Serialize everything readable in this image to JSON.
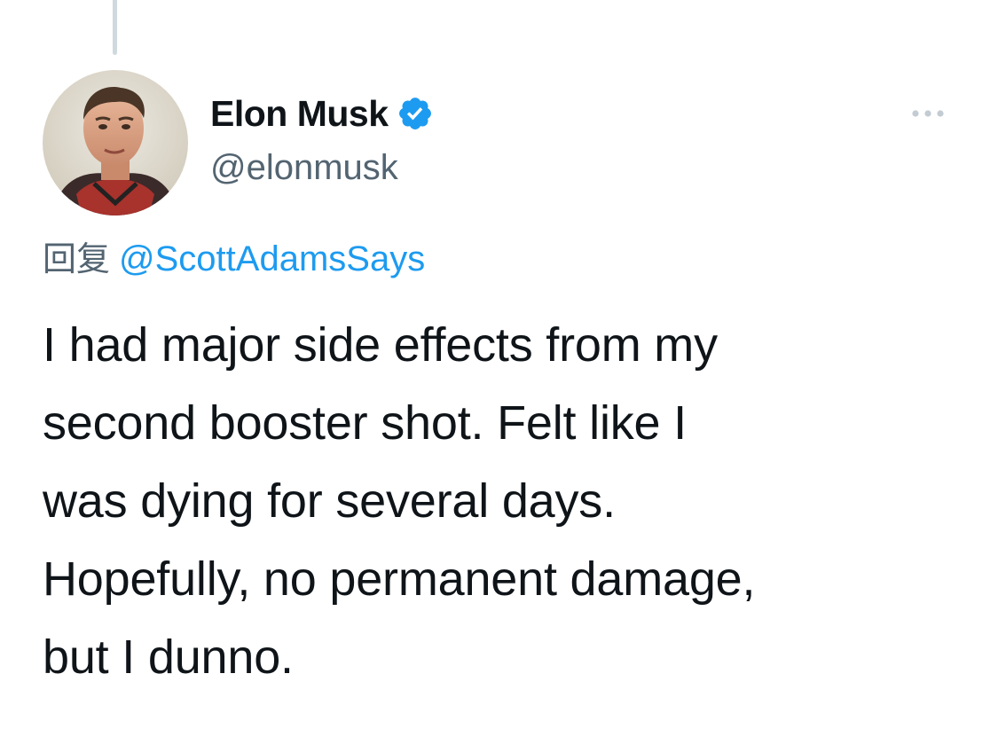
{
  "thread": {
    "connector": "thread-connector"
  },
  "author": {
    "name": "Elon Musk",
    "handle": "@elonmusk",
    "verified_icon": "verified-badge-icon",
    "verified_color": "#1d9bf0",
    "avatar_alt": "avatar"
  },
  "more_icon": "more-horizontal-icon",
  "reply": {
    "prefix": "回复",
    "handle": "@ScottAdamsSays",
    "handle_color": "#1d9bf0"
  },
  "tweet": {
    "lines": [
      "I had major side effects from my",
      "second booster shot. Felt like I",
      "was dying for several days.",
      "Hopefully, no permanent damage,",
      "but I dunno."
    ]
  }
}
